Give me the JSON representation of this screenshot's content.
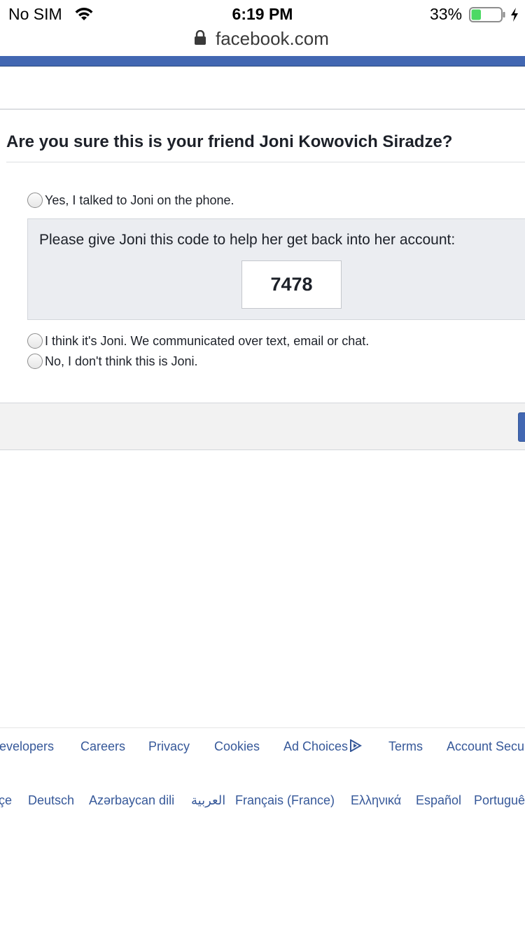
{
  "status_bar": {
    "carrier": "No SIM",
    "time": "6:19 PM",
    "battery_percent": "33%",
    "battery_level": 0.33,
    "charging": true
  },
  "browser": {
    "url": "facebook.com"
  },
  "colors": {
    "facebook_blue": "#4267b2",
    "link": "#365899",
    "panel_bg": "#ebedf1",
    "action_bar_bg": "#f2f2f2",
    "battery_green": "#4cd964"
  },
  "question": {
    "title": "Are you sure this is your friend Joni Kowovich Siradze?"
  },
  "options": [
    {
      "label": "Yes, I talked to Joni on the phone.",
      "selected": false
    },
    {
      "label": "I think it's Joni. We communicated over text, email or chat.",
      "selected": false
    },
    {
      "label": "No, I don't think this is Joni.",
      "selected": false
    }
  ],
  "code_panel": {
    "instructions": "Please give Joni this code to help her get back into her account:",
    "code": "7478"
  },
  "footer": {
    "links": [
      "Developers",
      "Careers",
      "Privacy",
      "Cookies",
      "Ad Choices",
      "Terms",
      "Account Security"
    ],
    "languages": [
      "Türkçe",
      "Deutsch",
      "Azərbaycan dili",
      "العربية",
      "Français (France)",
      "Ελληνικά",
      "Español",
      "Português"
    ]
  }
}
